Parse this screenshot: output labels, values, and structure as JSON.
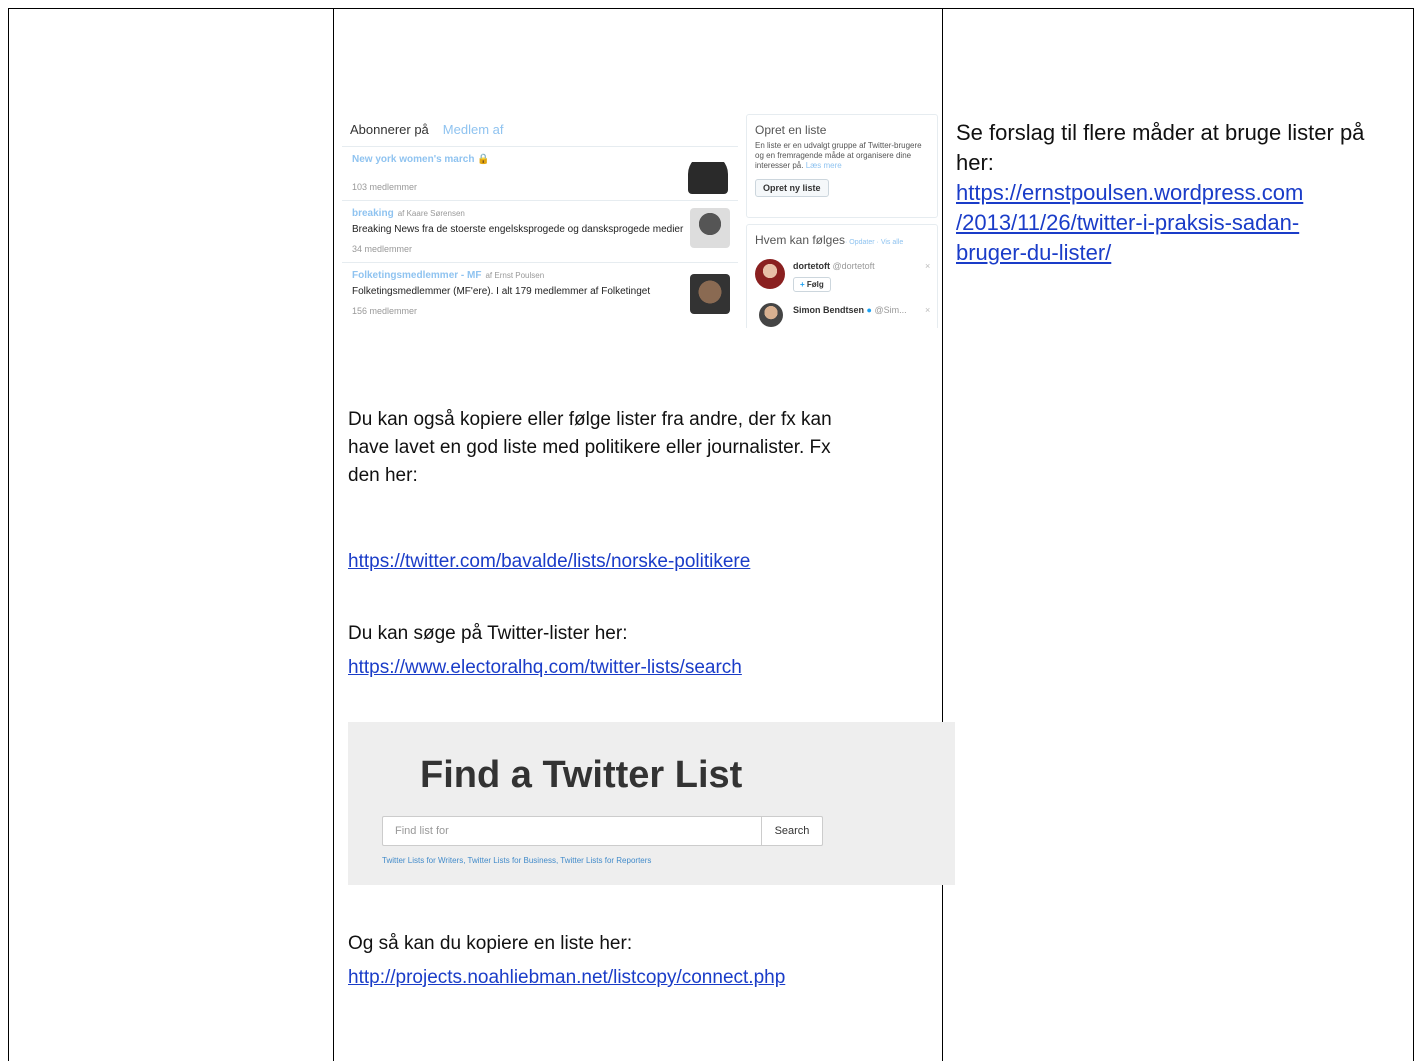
{
  "right_col": {
    "text": "Se forslag til flere måder at bruge lister på her:",
    "link": "https://ernstpoulsen.wordpress.com/2013/11/26/twitter-i-praksis-sadan-bruger-du-lister/",
    "link_line1": "https://ernstpoulsen.wordpress.com",
    "link_line2": "/2013/11/26/twitter-i-praksis-sadan-",
    "link_line3": "bruger-du-lister/"
  },
  "lists_shot": {
    "tab_subscribed": "Abonnerer på",
    "tab_member": "Medlem af",
    "lists": [
      {
        "name": "New york women's march",
        "by": "",
        "desc": "",
        "members": "103 medlemmer"
      },
      {
        "name": "breaking",
        "by": "af Kaare Sørensen",
        "desc": "Breaking News fra de stoerste engelsksprogede og dansksprogede medier",
        "members": "34 medlemmer"
      },
      {
        "name": "Folketingsmedlemmer - MF",
        "by": "af Ernst Poulsen",
        "desc": "Folketingsmedlemmer (MF'ere). I alt 179 medlemmer af Folketinget",
        "members": "156 medlemmer"
      }
    ],
    "create_title": "Opret en liste",
    "create_text": "En liste er en udvalgt gruppe af Twitter-brugere og en fremragende måde at organisere dine interesser på.",
    "create_more": "Læs mere",
    "create_button": "Opret ny liste",
    "who_title": "Hvem kan følges",
    "who_links": "· Opdater · Vis alle",
    "who": [
      {
        "name": "dortetoft",
        "handle": "@dortetoft",
        "button": "Følg"
      },
      {
        "name": "Simon Bendtsen",
        "handle": "@Sim...",
        "button": ""
      }
    ]
  },
  "para1": {
    "line1": "Du kan også kopiere eller følge lister fra andre, der fx kan",
    "line2": "have lavet en god liste med politikere eller journalister. Fx",
    "line3": "den her:"
  },
  "link1": "https://twitter.com/bavalde/lists/norske-politikere",
  "para2": "Du kan søge på Twitter-lister her:",
  "link2": "https://www.electoralhq.com/twitter-lists/search",
  "find_shot": {
    "title": "Find a Twitter List",
    "placeholder": "Find list for",
    "button": "Search",
    "links": "Twitter Lists for Writers, Twitter Lists for Business, Twitter Lists for Reporters"
  },
  "para3": "Og så kan du kopiere en liste her:",
  "link3": "http://projects.noahliebman.net/listcopy/connect.php"
}
